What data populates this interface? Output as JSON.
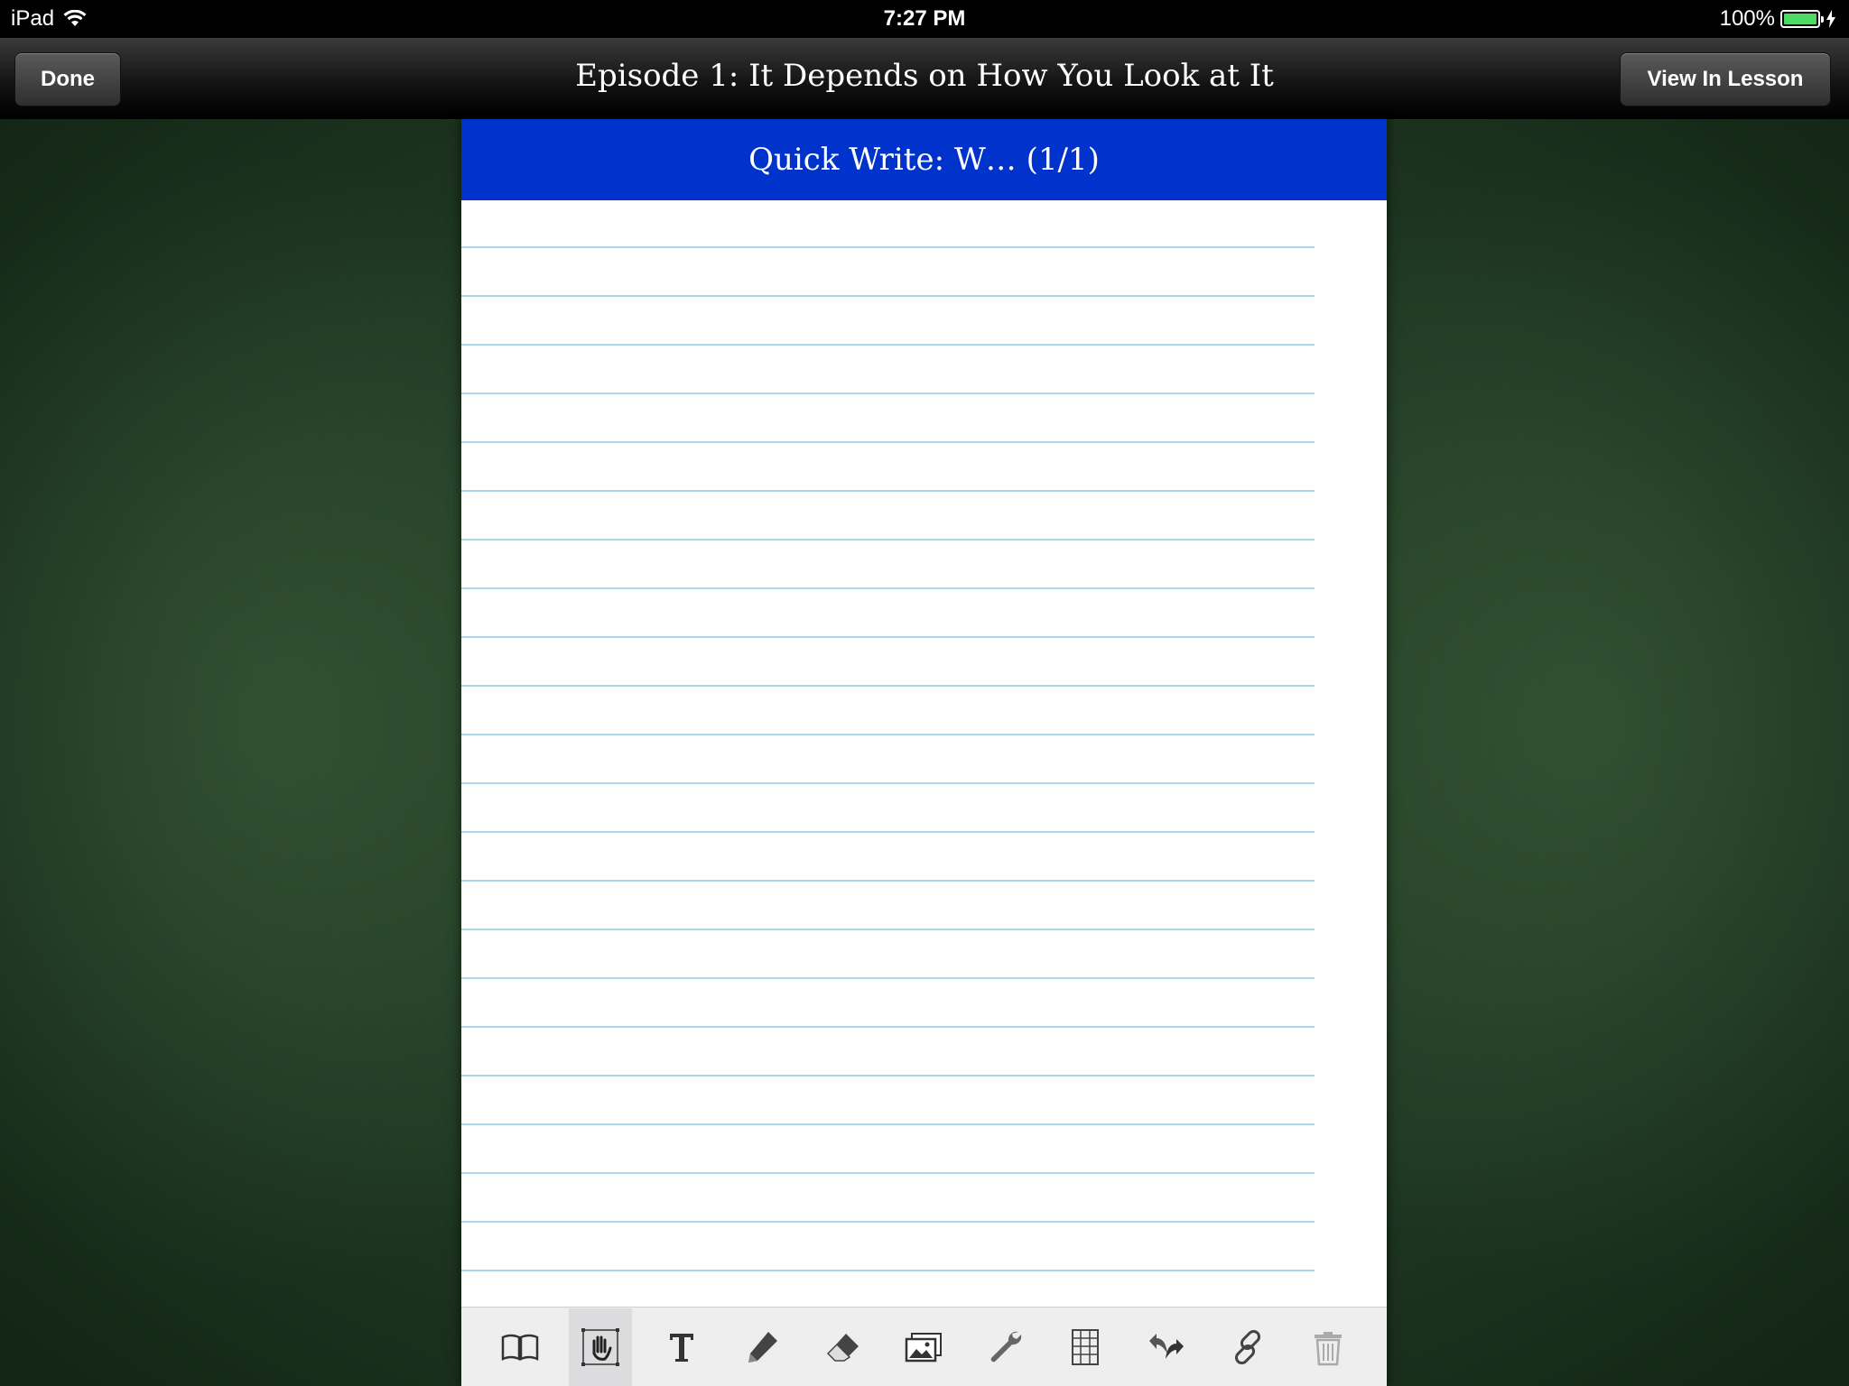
{
  "status_bar": {
    "device": "iPad",
    "time": "7:27 PM",
    "battery": "100%",
    "battery_color": "#4cd964"
  },
  "nav": {
    "done_label": "Done",
    "title": "Episode 1: It Depends on How You Look at It",
    "view_lesson_label": "View In Lesson"
  },
  "page": {
    "header_title": "Quick Write: W… (1/1)",
    "header_color": "#0033cc",
    "rule_color": "#a9d6ea"
  },
  "toolbar": {
    "tools": [
      {
        "name": "book-icon",
        "active": false
      },
      {
        "name": "pan-select-icon",
        "active": true
      },
      {
        "name": "text-icon",
        "active": false
      },
      {
        "name": "pencil-icon",
        "active": false
      },
      {
        "name": "eraser-icon",
        "active": false
      },
      {
        "name": "images-icon",
        "active": false
      },
      {
        "name": "wrench-icon",
        "active": false
      },
      {
        "name": "grid-icon",
        "active": false
      },
      {
        "name": "undo-redo-icon",
        "active": false
      },
      {
        "name": "link-icon",
        "active": false
      },
      {
        "name": "trash-icon",
        "active": false
      }
    ]
  }
}
